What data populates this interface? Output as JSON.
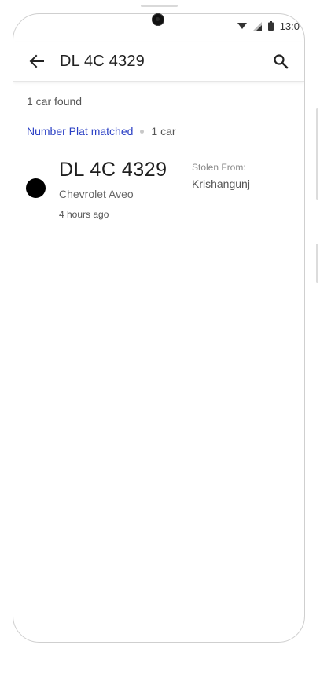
{
  "status_bar": {
    "time": "13:0",
    "wifi_icon": "wifi-icon",
    "signal_icon": "signal-icon",
    "battery_icon": "battery-icon"
  },
  "app_bar": {
    "title": "DL 4C 4329",
    "back_icon": "arrow-back-icon",
    "search_icon": "search-icon"
  },
  "results": {
    "count_text": "1 car found",
    "filter_label": "Number Plat matched",
    "filter_count": "1 car"
  },
  "items": [
    {
      "plate": "DL 4C 4329",
      "model": "Chevrolet Aveo",
      "time_ago": "4 hours ago",
      "stolen_label": "Stolen From:",
      "stolen_place": "Krishangunj",
      "status_color": "#000000"
    }
  ],
  "colors": {
    "accent": "#2a3fc4",
    "text_primary": "#222222",
    "text_secondary": "#555555"
  }
}
